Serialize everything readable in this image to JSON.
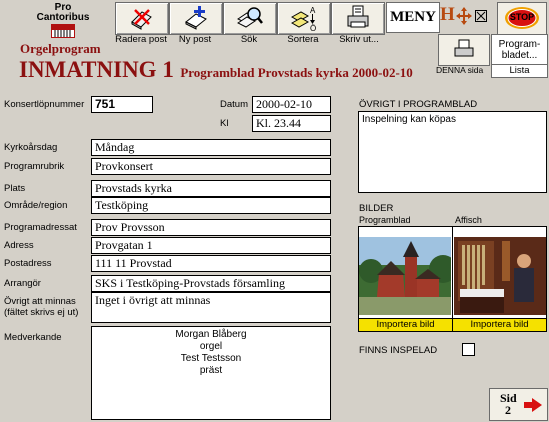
{
  "app": {
    "logo_line1": "Pro",
    "logo_line2": "Cantoribus",
    "module": "Orgelprogram",
    "title": "INMATNING 1",
    "subtitle": "Programblad Provstads kyrka 2000-02-10"
  },
  "toolbar": {
    "radera_label": "Radera post",
    "ny_label": "Ny post",
    "sok_label": "Sök",
    "sortera_label": "Sortera",
    "skriv_label": "Skriv ut...",
    "meny_label": "MENY",
    "h_label": "H",
    "stop_label": "STOP",
    "programblad_line1": "Program-",
    "programblad_line2": "bladet...",
    "denna_sida_label": "DENNA sida",
    "lista_label": "Lista"
  },
  "form": {
    "konsertlopnummer_label": "Konsertlöpnummer",
    "konsertlopnummer_value": "751",
    "datum_label": "Datum",
    "datum_value": "2000-02-10",
    "kl_label": "Kl",
    "kl_value": "Kl. 23.44",
    "kyrkoarsdag_label": "Kyrkoårsdag",
    "kyrkoarsdag_value": "Måndag",
    "programrubrik_label": "Programrubrik",
    "programrubrik_value": "Provkonsert",
    "plats_label": "Plats",
    "plats_value": "Provstads kyrka",
    "omrade_label": "Område/region",
    "omrade_value": "Testköping",
    "programadressat_label": "Programadressat",
    "programadressat_value": "Prov Provsson",
    "adress_label": "Adress",
    "adress_value": "Provgatan 1",
    "postadress_label": "Postadress",
    "postadress_value": "111 11 Provstad",
    "arrangor_label": "Arrangör",
    "arrangor_value": "SKS i Testköping-Provstads församling",
    "ovrigt_minnas_label1": "Övrigt att minnas",
    "ovrigt_minnas_label2": "(fältet skrivs ej ut)",
    "ovrigt_minnas_value": "Inget i övrigt att minnas",
    "medverkande_label": "Medverkande",
    "medverkande_lines": [
      "Morgan Blåberg",
      "orgel",
      "Test Testsson",
      "präst"
    ]
  },
  "right": {
    "ovrigt_label": "ÖVRIGT I PROGRAMBLAD",
    "ovrigt_value": "Inspelning kan köpas",
    "bilder_label": "BILDER",
    "programblad_img_label": "Programblad",
    "affisch_img_label": "Affisch",
    "importera1": "Importera bild",
    "importera2": "Importera bild",
    "finns_inspelad_label": "FINNS INSPELAD",
    "finns_inspelad_checked": false
  },
  "nav": {
    "sid_label": "Sid",
    "sid_number": "2"
  },
  "colors": {
    "title_red": "#8b1010",
    "import_yellow": "#f5e100"
  }
}
